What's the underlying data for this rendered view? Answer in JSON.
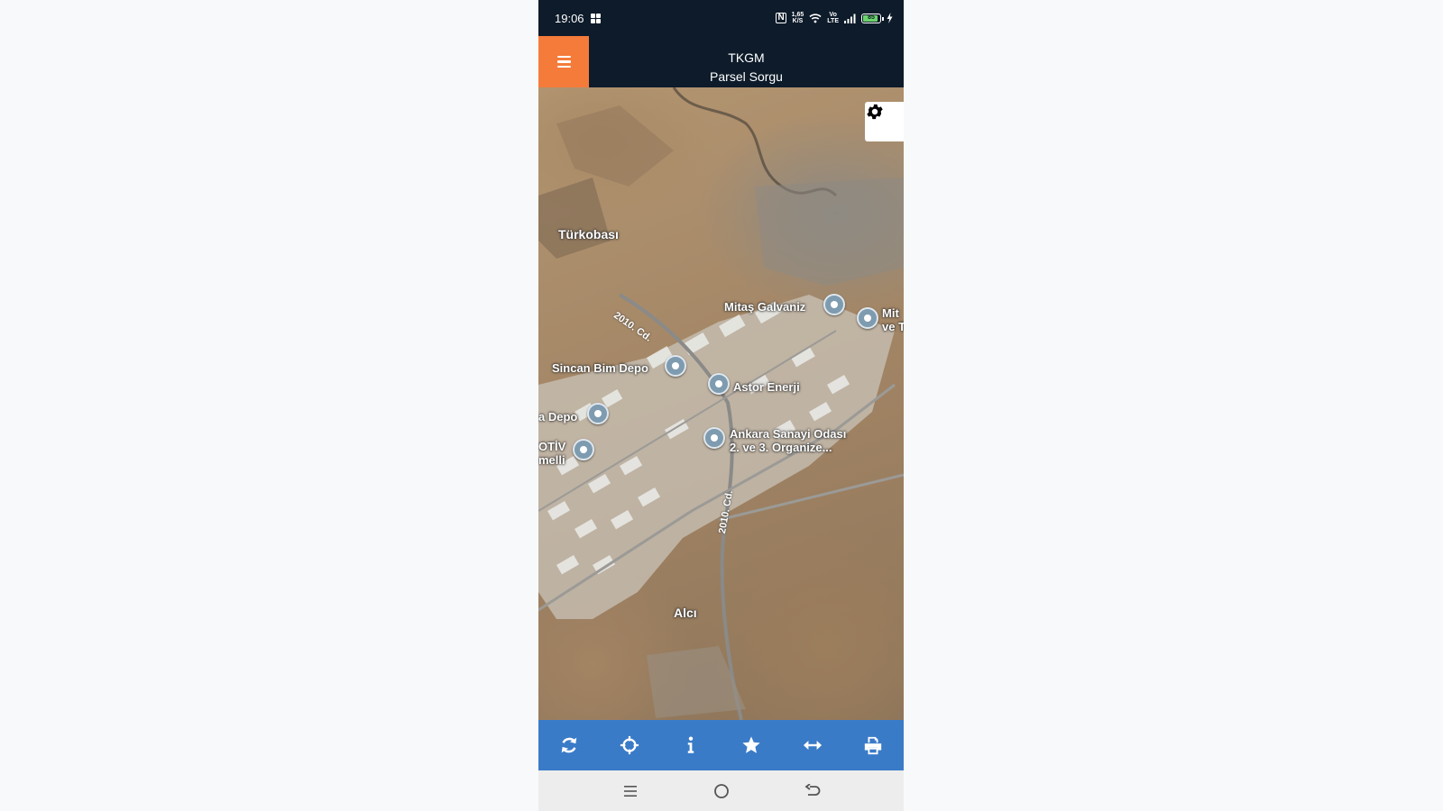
{
  "status_bar": {
    "time": "19:06",
    "network_speed": "1,65",
    "network_speed_unit": "K/S",
    "volte_line1": "Vo",
    "volte_line2": "LTE",
    "battery_level": "85",
    "icons": [
      "apps-grid-icon",
      "nfc-icon",
      "wifi-icon",
      "signal-icon",
      "battery-icon",
      "charging-icon"
    ]
  },
  "app_bar": {
    "title": "TKGM",
    "subtitle": "Parsel Sorgu",
    "menu_icon": "hamburger-menu-icon",
    "accent_color": "#f47b3a",
    "background_color": "#0d1b2a"
  },
  "map": {
    "labels": {
      "turkobasi": "Türkobası",
      "road_2010_top": "2010. Cd.",
      "road_2010_bottom": "2010. Cd.",
      "mitas_galvaniz": "Mitaş Galvaniz",
      "mitas_partial_line1": "Mit",
      "mitas_partial_line2": "ve T",
      "sincan_bim": "Sincan Bim Depo",
      "astor": "Astor Enerji",
      "depo_partial": "a Depo",
      "aso_line1": "Ankara Sanayi Odası",
      "aso_line2": "2. ve 3. Organize...",
      "otiv_line1": "OTİV",
      "otiv_line2": "melli",
      "alci": "Alcı"
    },
    "settings_icon": "gear-icon"
  },
  "toolbar": {
    "background_color": "#3a7bc8",
    "items": [
      {
        "icon": "refresh-icon"
      },
      {
        "icon": "crosshairs-icon"
      },
      {
        "icon": "info-icon"
      },
      {
        "icon": "star-icon"
      },
      {
        "icon": "measure-arrows-icon"
      },
      {
        "icon": "print-icon"
      }
    ]
  },
  "nav_bar": {
    "items": [
      {
        "icon": "recent-apps-icon"
      },
      {
        "icon": "home-icon"
      },
      {
        "icon": "back-icon"
      }
    ]
  }
}
